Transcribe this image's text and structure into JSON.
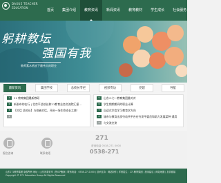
{
  "header": {
    "logo_line1": "DAXUE TEACHER",
    "logo_line2": "EDUCATION",
    "nav": [
      {
        "label": "首页",
        "active": false
      },
      {
        "label": "集团介绍",
        "active": false
      },
      {
        "label": "教育资讯",
        "active": true
      },
      {
        "label": "新闻资讯",
        "active": false
      },
      {
        "label": "教育教材",
        "active": false
      },
      {
        "label": "学生成长",
        "active": false
      },
      {
        "label": "社会服务",
        "active": false
      }
    ]
  },
  "banner": {
    "title1": "躬耕教坛",
    "title2": "强国有我",
    "subtitle": "教师素水纸底下最伟大的职业"
  },
  "tabs": [
    {
      "label": "最新资讯",
      "active": true
    },
    {
      "label": "集团学校",
      "active": false
    },
    {
      "label": "总校长专栏",
      "active": false
    },
    {
      "label": "视频专访",
      "active": false
    },
    {
      "label": "党建",
      "active": false
    },
    {
      "label": "导航",
      "active": false
    }
  ],
  "left_news": [
    {
      "tag": "1",
      "title": "21 教育集团最新教研"
    },
    {
      "tag": "2",
      "title": "新发布的在行 | 北京平总校长和21教育业务交流院汇报..."
    },
    {
      "tag": "3",
      "title": "【对话 总校长】与校者对话，开启一场生命成长之旅！"
    },
    {
      "tag": "4",
      "title": ""
    }
  ],
  "right_news": [
    {
      "tag": "5",
      "title": "山东二七一教育集团委对对"
    },
    {
      "tag": "6",
      "title": "学生期期期间的职业计算"
    },
    {
      "tag": "7",
      "title": "自适式学会学习教育学方向"
    },
    {
      "tag": "8",
      "title": "城市与教育出发行动共平台在行发平委员和助力发展某种 通用"
    },
    {
      "tag": "9",
      "title": "与交流交流"
    }
  ],
  "contact": {
    "left_label": "报名咨询",
    "mid_label": "联系电话",
    "phone_big": "271",
    "phone_hint": "咨询电话 0538-271 0000",
    "phone_number": "0538-271"
  },
  "footer": {
    "line1": "山东271教育集团 版权所有 地址：山东省泰安市 | 鲁ICP备案 | 联系电话：0538-2711000 | 技术支持：网站制作 | 学校招生：271教育集团 | 投诉建议 | 网站地图 | 友情链接",
    "line2": "Copyright © 271 Education Group All Rights Reserved"
  }
}
